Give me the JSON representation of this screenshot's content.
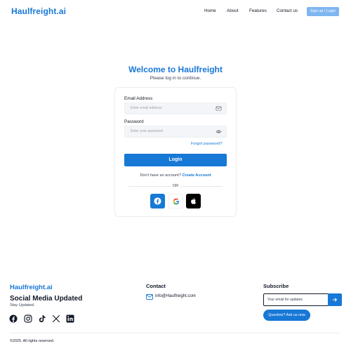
{
  "header": {
    "logo": "Haulfreight.ai",
    "nav": {
      "home": "Home",
      "about": "About",
      "features": "Features",
      "contact": "Contact us"
    },
    "signup_label": "Sign up / Login"
  },
  "login": {
    "title": "Welcome to Haulfreight",
    "subtitle": "Please log in to continue.",
    "email_label": "Email Address",
    "email_placeholder": "Enter email address",
    "password_label": "Password",
    "password_placeholder": "Enter your password",
    "forgot_label": "Forgot password?",
    "login_label": "Login",
    "no_account_text": "Don't have an account?",
    "create_account_label": "Create Account",
    "or_text": "OR",
    "social": [
      "facebook-icon",
      "google-icon",
      "apple-icon"
    ]
  },
  "footer": {
    "logo": "Haulfreight.ai",
    "social_title": "Social Media Updated",
    "social_subtitle": "Stay Updated.",
    "social_icons": [
      "facebook-icon",
      "instagram-icon",
      "tiktok-icon",
      "x-icon",
      "linkedin-icon"
    ],
    "contact_title": "Contact",
    "contact_email": "info@Haulfreight.com",
    "subscribe_title": "Subscribe",
    "subscribe_placeholder": "Your email for updates",
    "ask_label": "Question? Ask us now",
    "copyright": "©2025. All rights reserved."
  },
  "colors": {
    "brand": "#1778d6",
    "signup_button": "#7fb6ef",
    "apple_button": "#000000"
  }
}
